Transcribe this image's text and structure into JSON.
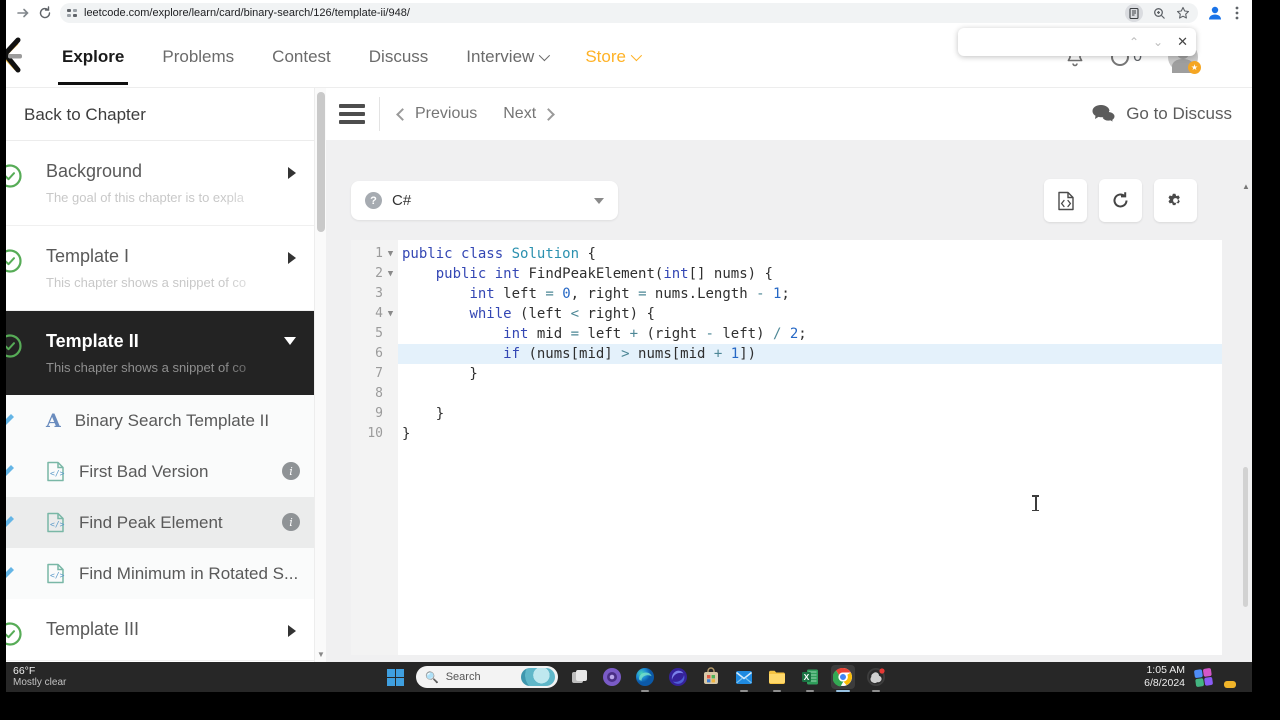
{
  "browser": {
    "url": "leetcode.com/explore/learn/card/binary-search/126/template-ii/948/",
    "icons": [
      "forward-arrow",
      "refresh",
      "site-info",
      "reader-mode",
      "zoom",
      "bookmark-star",
      "profile",
      "menu-dots"
    ],
    "findbar": {
      "value": "",
      "controls": [
        "chevron-up",
        "chevron-down",
        "close"
      ]
    }
  },
  "navbar": {
    "links": [
      {
        "label": "Explore",
        "active": true,
        "caret": false,
        "store": false
      },
      {
        "label": "Problems",
        "active": false,
        "caret": false,
        "store": false
      },
      {
        "label": "Contest",
        "active": false,
        "caret": false,
        "store": false
      },
      {
        "label": "Discuss",
        "active": false,
        "caret": false,
        "store": false
      },
      {
        "label": "Interview",
        "active": false,
        "caret": true,
        "store": false
      },
      {
        "label": "Store",
        "active": false,
        "caret": true,
        "store": true
      }
    ],
    "streak_count": "0"
  },
  "sidebar": {
    "back_label": "Back to Chapter",
    "chapters": [
      {
        "title": "Background",
        "subtitle": "The goal of this chapter is to expla",
        "state": "collapsed",
        "dark": false
      },
      {
        "title": "Template I",
        "subtitle": "This chapter shows a snippet of co",
        "state": "collapsed",
        "dark": false
      },
      {
        "title": "Template II",
        "subtitle": "This chapter shows a snippet of co",
        "state": "expanded",
        "dark": true,
        "items": [
          {
            "label": "Binary Search Template II",
            "icon": "article-icon",
            "info": false,
            "active": false
          },
          {
            "label": "First Bad Version",
            "icon": "code-doc-icon",
            "info": true,
            "active": false
          },
          {
            "label": "Find Peak Element",
            "icon": "code-doc-icon",
            "info": true,
            "active": true
          },
          {
            "label": "Find Minimum in Rotated S...",
            "icon": "code-doc-icon",
            "info": false,
            "active": false
          }
        ]
      },
      {
        "title": "Template III",
        "subtitle": "",
        "state": "collapsed",
        "dark": false
      }
    ]
  },
  "content": {
    "prev_label": "Previous",
    "next_label": "Next",
    "discuss_label": "Go to Discuss",
    "language": {
      "selected": "C#"
    },
    "toolbar_icons": [
      "code-file-icon",
      "reset-icon",
      "settings-gear-icon"
    ],
    "editor": {
      "lines": [
        {
          "n": "1",
          "fold": true,
          "hl": false,
          "tokens": [
            [
              "k",
              "public"
            ],
            [
              "p",
              " "
            ],
            [
              "k",
              "class"
            ],
            [
              "p",
              " "
            ],
            [
              "t",
              "Solution"
            ],
            [
              "p",
              " {"
            ]
          ]
        },
        {
          "n": "2",
          "fold": true,
          "hl": false,
          "tokens": [
            [
              "p",
              "    "
            ],
            [
              "k",
              "public"
            ],
            [
              "p",
              " "
            ],
            [
              "k",
              "int"
            ],
            [
              "p",
              " FindPeakElement("
            ],
            [
              "k",
              "int"
            ],
            [
              "p",
              "[] nums) {"
            ]
          ]
        },
        {
          "n": "3",
          "fold": false,
          "hl": false,
          "tokens": [
            [
              "p",
              "        "
            ],
            [
              "k",
              "int"
            ],
            [
              "p",
              " left "
            ],
            [
              "o",
              "="
            ],
            [
              "p",
              " "
            ],
            [
              "n",
              "0"
            ],
            [
              "p",
              ", right "
            ],
            [
              "o",
              "="
            ],
            [
              "p",
              " nums.Length "
            ],
            [
              "o",
              "-"
            ],
            [
              "p",
              " "
            ],
            [
              "n",
              "1"
            ],
            [
              "p",
              ";"
            ]
          ]
        },
        {
          "n": "4",
          "fold": true,
          "hl": false,
          "tokens": [
            [
              "p",
              "        "
            ],
            [
              "k",
              "while"
            ],
            [
              "p",
              " (left "
            ],
            [
              "o",
              "<"
            ],
            [
              "p",
              " right) {"
            ]
          ]
        },
        {
          "n": "5",
          "fold": false,
          "hl": false,
          "tokens": [
            [
              "p",
              "            "
            ],
            [
              "k",
              "int"
            ],
            [
              "p",
              " mid "
            ],
            [
              "o",
              "="
            ],
            [
              "p",
              " left "
            ],
            [
              "o",
              "+"
            ],
            [
              "p",
              " (right "
            ],
            [
              "o",
              "-"
            ],
            [
              "p",
              " left) "
            ],
            [
              "o",
              "/"
            ],
            [
              "p",
              " "
            ],
            [
              "n",
              "2"
            ],
            [
              "p",
              ";"
            ]
          ]
        },
        {
          "n": "6",
          "fold": false,
          "hl": true,
          "tokens": [
            [
              "p",
              "            "
            ],
            [
              "k",
              "if"
            ],
            [
              "p",
              " (nums[mid] "
            ],
            [
              "o",
              ">"
            ],
            [
              "p",
              " nums[mid "
            ],
            [
              "o",
              "+"
            ],
            [
              "p",
              " "
            ],
            [
              "n",
              "1"
            ],
            [
              "p",
              "])"
            ]
          ]
        },
        {
          "n": "7",
          "fold": false,
          "hl": false,
          "tokens": [
            [
              "p",
              "        }"
            ]
          ]
        },
        {
          "n": "8",
          "fold": false,
          "hl": false,
          "tokens": []
        },
        {
          "n": "9",
          "fold": false,
          "hl": false,
          "tokens": [
            [
              "p",
              "    }"
            ]
          ]
        },
        {
          "n": "10",
          "fold": false,
          "hl": false,
          "tokens": [
            [
              "p",
              "}"
            ]
          ]
        }
      ]
    }
  },
  "taskbar": {
    "weather_temp": "66°F",
    "weather_desc": "Mostly clear",
    "search_placeholder": "Search",
    "time": "1:05 AM",
    "date": "6/8/2024",
    "apps": [
      {
        "name": "task-view",
        "open": false,
        "active": false
      },
      {
        "name": "purple-app",
        "open": false,
        "active": false
      },
      {
        "name": "edge",
        "open": true,
        "active": false
      },
      {
        "name": "swirl-app",
        "open": false,
        "active": false
      },
      {
        "name": "store",
        "open": false,
        "active": false
      },
      {
        "name": "mail",
        "open": true,
        "active": false
      },
      {
        "name": "file-explorer",
        "open": true,
        "active": false
      },
      {
        "name": "excel",
        "open": true,
        "active": false
      },
      {
        "name": "chrome",
        "open": true,
        "active": true
      },
      {
        "name": "obs",
        "open": true,
        "active": false
      }
    ]
  },
  "colors": {
    "accent_store": "#ffb226",
    "keyword": "#3447b4",
    "number": "#2668c5",
    "operator": "#4d8796",
    "classname": "#2b91af",
    "line_highlight": "#e4f1fb",
    "taskbar_bg": "#272727"
  }
}
